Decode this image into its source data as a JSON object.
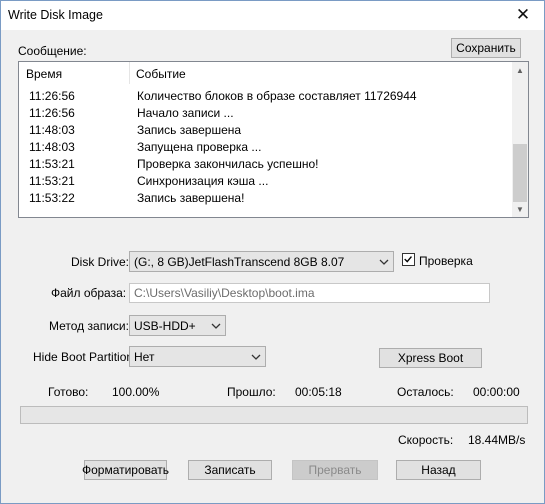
{
  "window": {
    "title": "Write Disk Image",
    "close_glyph": "✕"
  },
  "message": {
    "label": "Сообщение:",
    "save_button": "Сохранить",
    "columns": [
      "Время",
      "Событие"
    ],
    "rows": [
      {
        "time": "11:26:56",
        "event": "Количество блоков в образе составляет 11726944"
      },
      {
        "time": "11:26:56",
        "event": "Начало записи ..."
      },
      {
        "time": "11:48:03",
        "event": "Запись завершена"
      },
      {
        "time": "11:48:03",
        "event": "Запущена проверка ..."
      },
      {
        "time": "11:53:21",
        "event": "Проверка закончилась успешно!"
      },
      {
        "time": "11:53:21",
        "event": "Синхронизация кэша ..."
      },
      {
        "time": "11:53:22",
        "event": "Запись завершена!"
      }
    ]
  },
  "disk_drive": {
    "label": "Disk Drive:",
    "value": "(G:, 8 GB)JetFlashTranscend 8GB   8.07"
  },
  "verify": {
    "label": "Проверка",
    "checked": true
  },
  "image_file": {
    "label": "Файл образа:",
    "value": "C:\\Users\\Vasiliy\\Desktop\\boot.ima"
  },
  "write_method": {
    "label": "Метод записи:",
    "value": "USB-HDD+"
  },
  "hide_boot": {
    "label": "Hide Boot Partition:",
    "value": "Нет"
  },
  "xpress_boot": "Xpress Boot",
  "stats": {
    "done_label": "Готово:",
    "done_value": "100.00%",
    "elapsed_label": "Прошло:",
    "elapsed_value": "00:05:18",
    "remaining_label": "Осталось:",
    "remaining_value": "00:00:00",
    "speed_label": "Скорость:",
    "speed_value": "18.44MB/s"
  },
  "progress": {
    "fraction": 0
  },
  "buttons": {
    "format": "Форматировать",
    "write": "Записать",
    "abort": "Прервать",
    "back": "Назад"
  },
  "colors": {
    "progress_fill": "#06b025"
  }
}
